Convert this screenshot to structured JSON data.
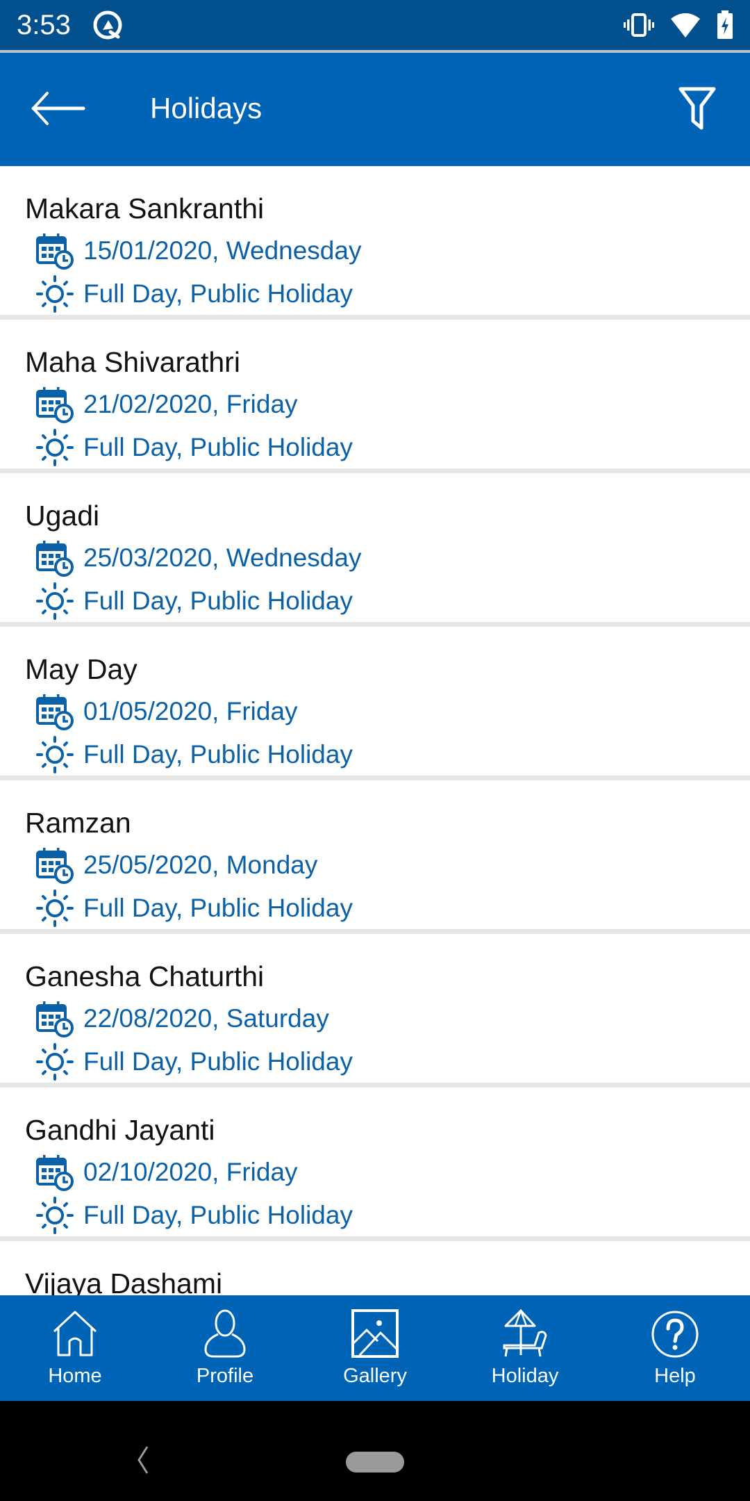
{
  "status_bar": {
    "time": "3:53",
    "icons": [
      "app-notification-icon",
      "vibrate-icon",
      "wifi-icon",
      "battery-charging-icon"
    ]
  },
  "app_bar": {
    "title": "Holidays",
    "back_icon": "arrow-left-icon",
    "filter_icon": "filter-icon"
  },
  "colors": {
    "status_bar": "#03508f",
    "primary": "#0064b6",
    "detail_text": "#0b61a8",
    "title_text": "#111111",
    "divider": "#e6e6e6"
  },
  "holidays": [
    {
      "name": "Makara Sankranthi",
      "date": "15/01/2020, Wednesday",
      "type": "Full Day, Public Holiday"
    },
    {
      "name": "Maha Shivarathri",
      "date": "21/02/2020, Friday",
      "type": "Full Day, Public Holiday"
    },
    {
      "name": "Ugadi",
      "date": "25/03/2020, Wednesday",
      "type": "Full Day, Public Holiday"
    },
    {
      "name": "May Day",
      "date": "01/05/2020, Friday",
      "type": "Full Day, Public Holiday"
    },
    {
      "name": "Ramzan",
      "date": "25/05/2020, Monday",
      "type": "Full Day, Public Holiday"
    },
    {
      "name": "Ganesha Chaturthi",
      "date": "22/08/2020, Saturday",
      "type": "Full Day, Public Holiday"
    },
    {
      "name": "Gandhi Jayanti",
      "date": "02/10/2020, Friday",
      "type": "Full Day, Public Holiday"
    },
    {
      "name": "Vijaya Dashami",
      "date": "",
      "type": ""
    }
  ],
  "bottom_nav": [
    {
      "label": "Home",
      "icon": "home-icon"
    },
    {
      "label": "Profile",
      "icon": "profile-icon"
    },
    {
      "label": "Gallery",
      "icon": "gallery-icon"
    },
    {
      "label": "Holiday",
      "icon": "beach-chair-icon"
    },
    {
      "label": "Help",
      "icon": "help-icon"
    }
  ]
}
